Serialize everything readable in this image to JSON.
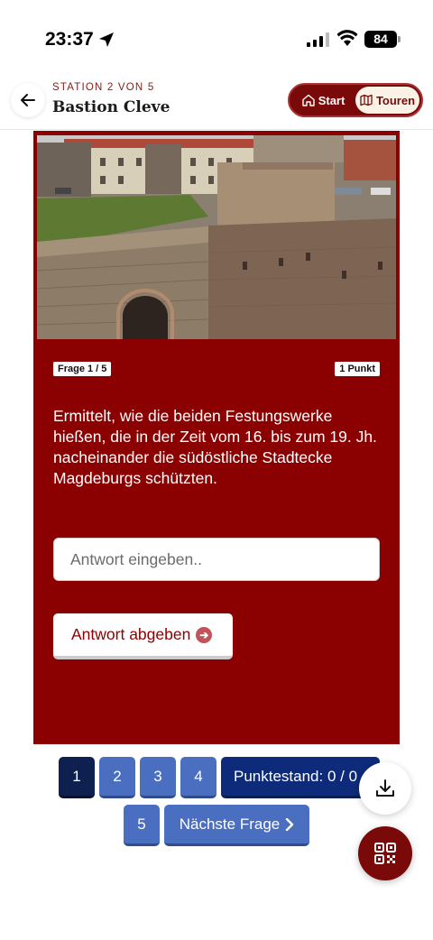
{
  "status_bar": {
    "time": "23:37",
    "battery": "84",
    "location_icon": "location-arrow-icon",
    "signal_icon": "cellular-signal-icon",
    "wifi_icon": "wifi-icon"
  },
  "header": {
    "station_label": "STATION 2 VON 5",
    "title": "Bastion Cleve",
    "back_icon": "arrow-left-icon",
    "nav": {
      "start_label": "Start",
      "touren_label": "Touren",
      "start_icon": "home-icon",
      "touren_icon": "map-icon"
    }
  },
  "quiz": {
    "question_counter": "Frage 1 / 5",
    "points": "1 Punkt",
    "question": "Ermittelt, wie die beiden Festungswerke hießen, die in der Zeit vom 16. bis zum 19. Jh. nacheinander die südöstliche Stadtecke Magdeburgs schützten.",
    "answer_placeholder": "Antwort eingeben..",
    "answer_value": "",
    "submit_label": "Antwort abgeben"
  },
  "pagination": {
    "pages": [
      "1",
      "2",
      "3",
      "4",
      "5"
    ],
    "active_page": "1",
    "score_label": "Punktestand: 0 / 0",
    "next_label": "Nächste Frage"
  },
  "fabs": {
    "download_icon": "download-icon",
    "qr_icon": "qr-code-scan-icon"
  },
  "colors": {
    "primary": "#8b0000",
    "pager": "#4b6fc0",
    "pager_active": "#0d2050",
    "score": "#0d2b7a",
    "accent_cream": "#fbf2e6"
  }
}
